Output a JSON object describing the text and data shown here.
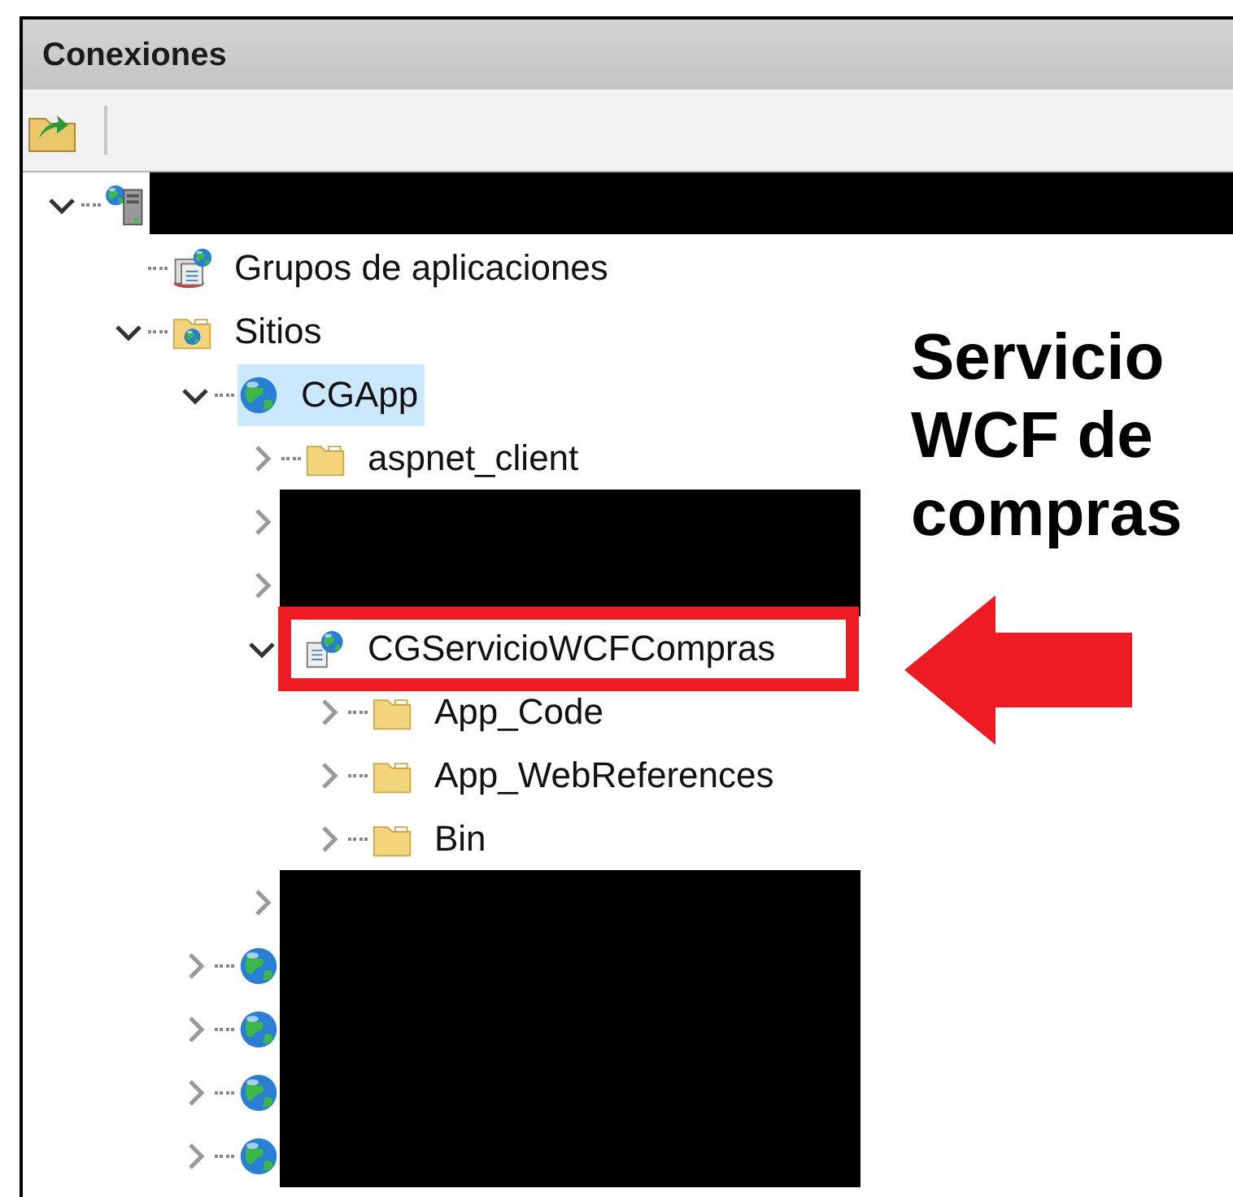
{
  "panel": {
    "title": "Conexiones"
  },
  "tree": [
    {
      "kind": "server",
      "expanded": true,
      "redacted": true,
      "selected": false,
      "callout": false,
      "children": [
        {
          "kind": "app-pools",
          "label": "Grupos de aplicaciones",
          "redacted": false,
          "selected": false,
          "callout": false
        },
        {
          "kind": "sites",
          "label": "Sitios",
          "expanded": true,
          "redacted": false,
          "selected": false,
          "callout": false,
          "children": [
            {
              "kind": "site",
              "label": "CGApp",
              "expanded": true,
              "redacted": false,
              "selected": true,
              "callout": false,
              "children": [
                {
                  "kind": "folder",
                  "label": "aspnet_client",
                  "expanded": false,
                  "redacted": false,
                  "selected": false,
                  "callout": false
                },
                {
                  "expanded": false,
                  "redacted": true,
                  "selected": false,
                  "callout": false
                },
                {
                  "expanded": false,
                  "redacted": true,
                  "selected": false,
                  "callout": false
                },
                {
                  "kind": "application",
                  "label": "CGServicioWCFCompras",
                  "expanded": true,
                  "redacted": false,
                  "selected": false,
                  "callout": true,
                  "children": [
                    {
                      "kind": "folder",
                      "label": "App_Code",
                      "expanded": false,
                      "redacted": false,
                      "selected": false,
                      "callout": false
                    },
                    {
                      "kind": "folder",
                      "label": "App_WebReferences",
                      "expanded": false,
                      "redacted": false,
                      "selected": false,
                      "callout": false
                    },
                    {
                      "kind": "folder",
                      "label": "Bin",
                      "expanded": false,
                      "redacted": false,
                      "selected": false,
                      "callout": false
                    }
                  ]
                },
                {
                  "expanded": false,
                  "redacted": true,
                  "selected": false,
                  "callout": false
                }
              ]
            },
            {
              "kind": "site",
              "expanded": false,
              "redacted": true,
              "selected": false,
              "callout": false
            },
            {
              "kind": "site",
              "expanded": false,
              "redacted": true,
              "selected": false,
              "callout": false
            },
            {
              "kind": "site",
              "expanded": false,
              "redacted": true,
              "selected": false,
              "callout": false
            },
            {
              "kind": "site",
              "expanded": false,
              "redacted": true,
              "selected": false,
              "callout": false
            }
          ]
        }
      ]
    }
  ],
  "annotation": {
    "text": "Servicio WCF de compras"
  }
}
